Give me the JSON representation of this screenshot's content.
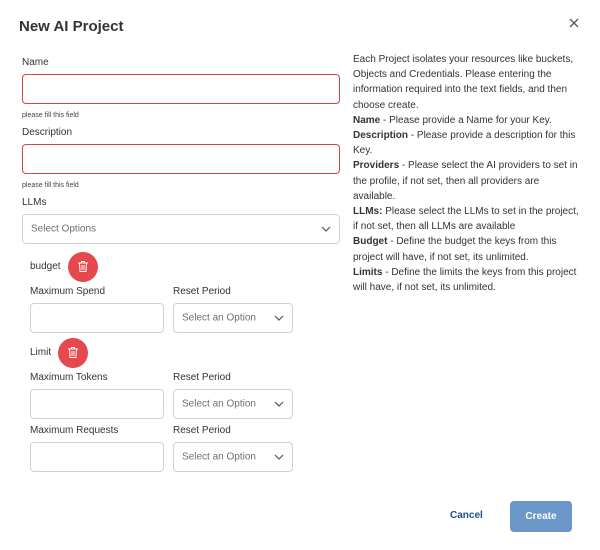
{
  "modal": {
    "title": "New AI Project",
    "close_icon": "close-icon"
  },
  "form": {
    "name": {
      "label": "Name",
      "value": "",
      "hint": "please fill this field"
    },
    "description": {
      "label": "Description",
      "value": "",
      "hint": "please fill this field"
    },
    "llms": {
      "label": "LLMs",
      "placeholder": "Select Options"
    },
    "budget": {
      "label": "budget",
      "max_spend_label": "Maximum Spend",
      "reset_label": "Reset Period",
      "reset_placeholder": "Select an Option"
    },
    "limit": {
      "label": "Limit",
      "max_tokens_label": "Maximum Tokens",
      "tokens_reset_label": "Reset Period",
      "tokens_reset_placeholder": "Select an Option",
      "max_requests_label": "Maximum Requests",
      "requests_reset_label": "Reset Period",
      "requests_reset_placeholder": "Select an Option"
    }
  },
  "help": {
    "intro": "Each Project isolates your resources like buckets, Objects and Credentials. Please entering the information required into the text fields, and then choose create.",
    "name_term": "Name",
    "name_text": " - Please provide a Name for your Key.",
    "description_term": "Description",
    "description_text": " - Please provide a description for this Key.",
    "providers_term": "Providers",
    "providers_text": " - Please select the AI providers to set in the profile, if not set, then all providers are available.",
    "llms_term": "LLMs:",
    "llms_text": " Please select the LLMs to set in the project, if not set, then all LLMs are available",
    "budget_term": "Budget",
    "budget_text": " - Define the budget the keys from this project will have, if not set, its unlimited.",
    "limits_term": "Limits",
    "limits_text": " - Define the limits the keys from this project will have, if not set, its unlimited."
  },
  "footer": {
    "cancel_label": "Cancel",
    "create_label": "Create"
  },
  "colors": {
    "error_border": "#d2454c",
    "delete_button": "#e5484d",
    "primary_button": "#6a96c8",
    "link": "#1f4f84"
  }
}
